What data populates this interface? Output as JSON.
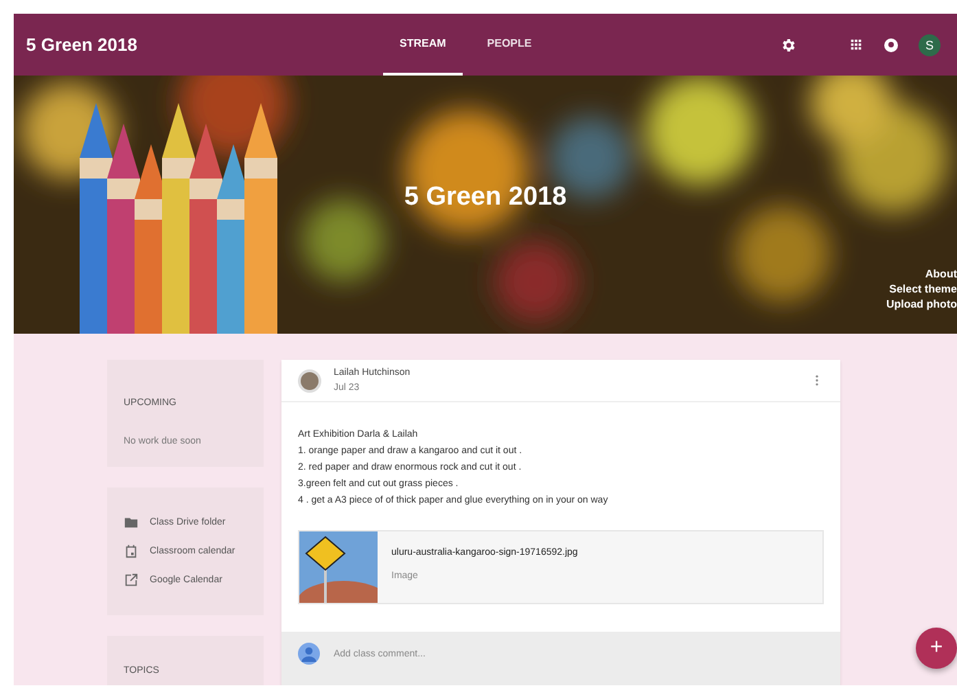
{
  "header": {
    "title": "5 Green 2018",
    "tabs": [
      {
        "label": "STREAM",
        "selected": true
      },
      {
        "label": "PEOPLE",
        "selected": false
      }
    ],
    "avatar_letter": "S"
  },
  "banner": {
    "title": "5 Green 2018",
    "links": [
      "About",
      "Select theme",
      "Upload photo"
    ]
  },
  "upcoming": {
    "heading": "UPCOMING",
    "text": "No work due soon"
  },
  "links": [
    {
      "kind": "folder",
      "label": "Class Drive folder"
    },
    {
      "kind": "calendar",
      "label": "Classroom calendar"
    },
    {
      "kind": "external",
      "label": "Google Calendar"
    }
  ],
  "topics": {
    "heading": "TOPICS"
  },
  "post": {
    "author": "Lailah Hutchinson",
    "date": "Jul 23",
    "lines": [
      "Art Exhibition Darla & Lailah",
      "1. orange paper and draw a kangaroo and cut it out .",
      "2. red paper and draw enormous rock and cut it out .",
      "3.green felt and cut out grass pieces .",
      "4 . get a A3 piece of of thick paper and glue everything on in your on way"
    ],
    "attachment": {
      "name": "uluru-australia-kangaroo-sign-19716592.jpg",
      "type": "Image"
    },
    "comment": {
      "placeholder": "Add class comment..."
    }
  },
  "fab": {
    "label": "+"
  }
}
